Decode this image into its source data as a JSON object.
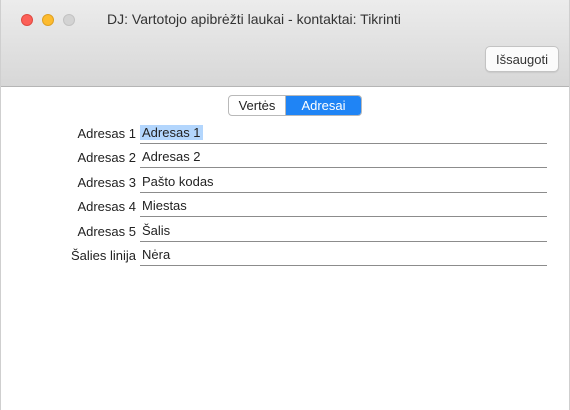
{
  "window": {
    "title": "DJ: Vartotojo apibrėžti laukai - kontaktai: Tikrinti",
    "save_label": "Išsaugoti"
  },
  "tabs": [
    {
      "label": "Vertės",
      "active": false
    },
    {
      "label": "Adresai",
      "active": true
    }
  ],
  "fields": [
    {
      "label": "Adresas 1",
      "value": "Adresas 1",
      "selected": true
    },
    {
      "label": "Adresas 2",
      "value": "Adresas 2"
    },
    {
      "label": "Adresas 3",
      "value": "Pašto kodas"
    },
    {
      "label": "Adresas 4",
      "value": "Miestas"
    },
    {
      "label": "Adresas 5",
      "value": "Šalis"
    },
    {
      "label": "Šalies linija",
      "value": "Nėra"
    }
  ],
  "colors": {
    "accent": "#1f84f5",
    "selection": "#b3d6fd",
    "close": "#fc5f57",
    "minimize": "#fdbb2e",
    "zoom_disabled": "#d3d3d3"
  }
}
